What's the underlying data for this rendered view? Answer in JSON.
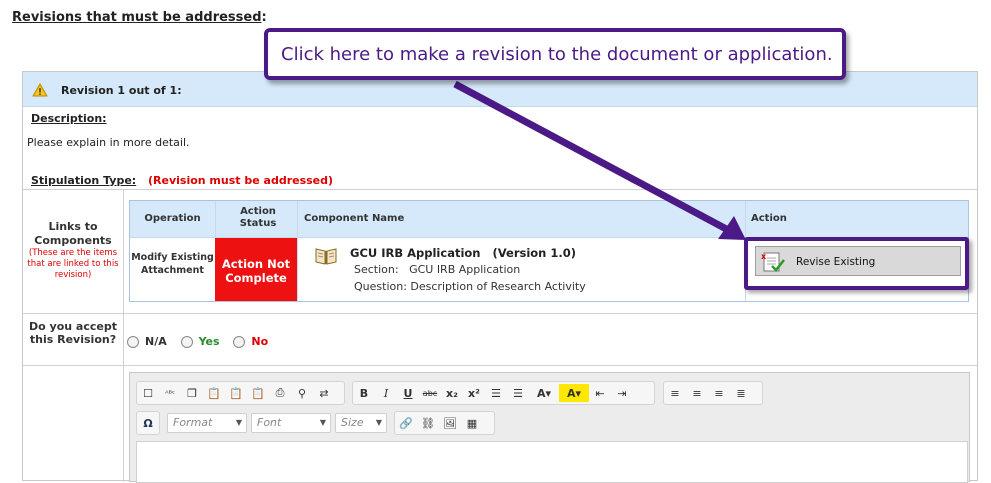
{
  "heading": {
    "label": "Revisions that must be addressed",
    "colon": ":"
  },
  "revision": {
    "title": "Revision 1 out of 1:",
    "description_label": "Description:",
    "description_text": "Please explain in more detail.",
    "stipulation_label": "Stipulation Type:",
    "stipulation_note": "(Revision must be addressed)"
  },
  "links": {
    "label": "Links to Components",
    "note": "(These are the items that are linked to this revision)"
  },
  "components": {
    "headers": {
      "operation": "Operation",
      "action_status": "Action Status",
      "component_name": "Component Name",
      "action": "Action"
    },
    "row": {
      "operation": "Modify Existing Attachment",
      "status": "Action Not Complete",
      "name": "GCU IRB Application   (Version 1.0)",
      "section": "Section:   GCU IRB Application",
      "question": "Question: Description of Research Activity",
      "button": "Revise Existing"
    }
  },
  "accept": {
    "label": "Do you accept this Revision?",
    "options": {
      "na": "N/A",
      "yes": "Yes",
      "no": "No"
    }
  },
  "editor": {
    "format_placeholder": "Format",
    "font_placeholder": "Font",
    "size_placeholder": "Size"
  },
  "callout": {
    "text": "Click here to make a revision to the document or application."
  },
  "colors": {
    "accent": "#4b1a86",
    "status_red": "#ee1111",
    "header_blue": "#d6e9fb"
  }
}
